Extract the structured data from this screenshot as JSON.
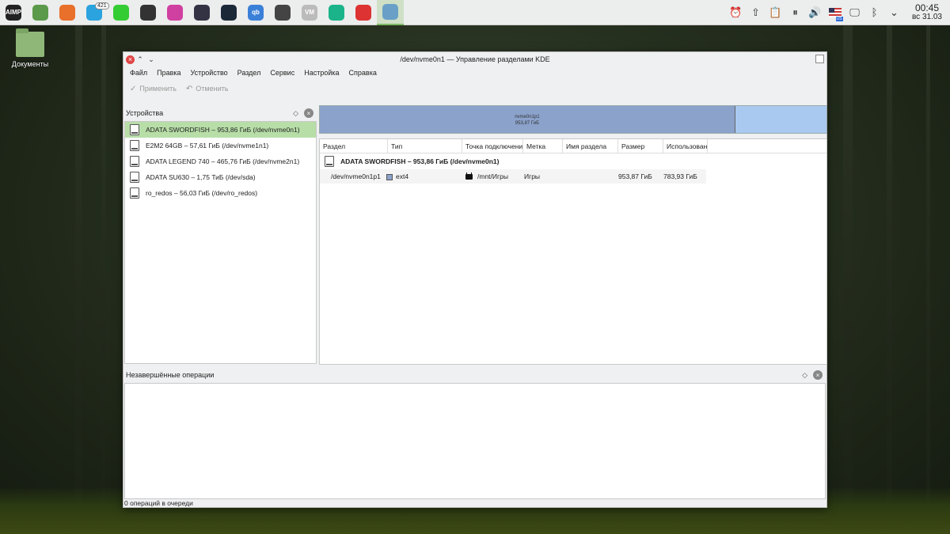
{
  "taskbar": {
    "apps": [
      {
        "name": "aimp-icon",
        "color": "#222",
        "label": "AIMP"
      },
      {
        "name": "file-manager-icon",
        "color": "#5a9a4a",
        "label": ""
      },
      {
        "name": "firefox-icon",
        "color": "#e8702a",
        "label": ""
      },
      {
        "name": "telegram-icon",
        "color": "#2aa3de",
        "label": "",
        "badge": "421"
      },
      {
        "name": "cura-icon",
        "color": "#3c3",
        "label": ""
      },
      {
        "name": "obs-icon",
        "color": "#333",
        "label": ""
      },
      {
        "name": "krita-icon",
        "color": "#d040a0",
        "label": ""
      },
      {
        "name": "davinci-icon",
        "color": "#334",
        "label": ""
      },
      {
        "name": "steam-icon",
        "color": "#1b2838",
        "label": ""
      },
      {
        "name": "qbittorrent-icon",
        "color": "#3a80d8",
        "label": "qb"
      },
      {
        "name": "inkscape-icon",
        "color": "#444",
        "label": ""
      },
      {
        "name": "vivaldi-icon",
        "color": "#bbb",
        "label": "VM"
      },
      {
        "name": "phone-icon",
        "color": "#1ab38a",
        "label": ""
      },
      {
        "name": "tape-icon",
        "color": "#d33",
        "label": ""
      },
      {
        "name": "partition-manager-icon",
        "color": "#6aa0c8",
        "label": ""
      }
    ],
    "clock_time": "00:45",
    "clock_date": "вс 31.03",
    "lang": "US"
  },
  "desktop": {
    "folder_label": "Документы"
  },
  "window": {
    "title": "/dev/nvme0n1 — Управление разделами KDE",
    "menu": [
      "Файл",
      "Правка",
      "Устройство",
      "Раздел",
      "Сервис",
      "Настройка",
      "Справка"
    ],
    "toolbar": {
      "apply": "Применить",
      "undo": "Отменить"
    },
    "devices_title": "Устройства",
    "devices": [
      "ADATA SWORDFISH – 953,86 ГиБ (/dev/nvme0n1)",
      "E2M2 64GB – 57,61 ГиБ (/dev/nvme1n1)",
      "ADATA LEGEND 740 – 465,76 ГиБ (/dev/nvme2n1)",
      "ADATA SU630 – 1,75 ТиБ (/dev/sda)",
      "ro_redos – 56,03 ГиБ (/dev/ro_redos)"
    ],
    "bar": {
      "name": "nvme0n1p1",
      "size": "953,87 ГиБ",
      "used_fraction": 0.82
    },
    "columns": [
      "Раздел",
      "Тип",
      "Точка подключения",
      "Метка",
      "Имя раздела",
      "Размер",
      "Использовано"
    ],
    "group": "ADATA SWORDFISH – 953,86 ГиБ (/dev/nvme0n1)",
    "partition": {
      "name": "/dev/nvme0n1p1",
      "type": "ext4",
      "mount": "/mnt/Игры",
      "label": "Игры",
      "size": "953,87 ГиБ",
      "used": "783,93 ГиБ"
    },
    "pending_title": "Незавершённые операции",
    "status": "0 операций в очереди"
  }
}
